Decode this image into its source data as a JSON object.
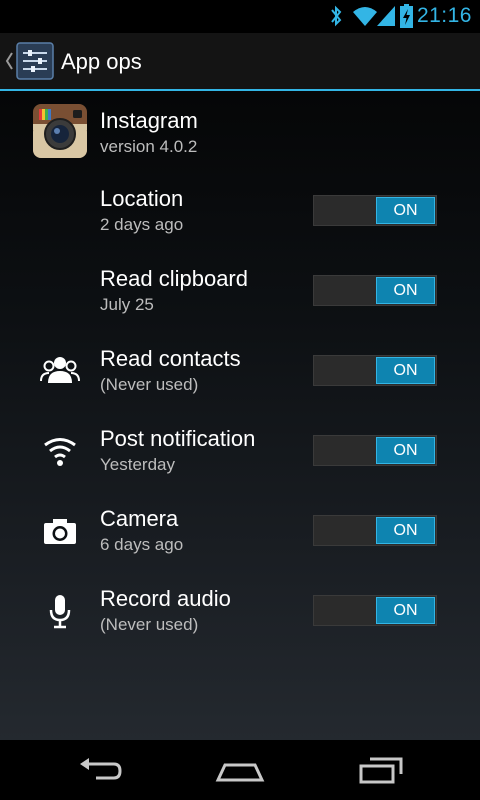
{
  "status_bar": {
    "time": "21:16",
    "icons": [
      "bluetooth-icon",
      "wifi-icon",
      "signal-icon",
      "battery-charging-icon"
    ],
    "accent_color": "#33b5e5"
  },
  "action_bar": {
    "title": "App ops",
    "icon": "settings-sliders-icon",
    "up_icon": "up-caret-icon"
  },
  "app": {
    "name": "Instagram",
    "version": "version 4.0.2",
    "icon": "instagram-camera-icon"
  },
  "operations": [
    {
      "label": "Location",
      "last_used": "2 days ago",
      "state": "ON",
      "icon": ""
    },
    {
      "label": "Read clipboard",
      "last_used": "July 25",
      "state": "ON",
      "icon": ""
    },
    {
      "label": "Read contacts",
      "last_used": "(Never used)",
      "state": "ON",
      "icon": "contacts-icon"
    },
    {
      "label": "Post notification",
      "last_used": "Yesterday",
      "state": "ON",
      "icon": "notification-wifi-icon"
    },
    {
      "label": "Camera",
      "last_used": "6 days ago",
      "state": "ON",
      "icon": "camera-icon"
    },
    {
      "label": "Record audio",
      "last_used": "(Never used)",
      "state": "ON",
      "icon": "microphone-icon"
    }
  ],
  "toggle_on_color": "#0e84b0",
  "nav_bar": {
    "buttons": [
      "back-icon",
      "home-icon",
      "recent-apps-icon"
    ]
  }
}
